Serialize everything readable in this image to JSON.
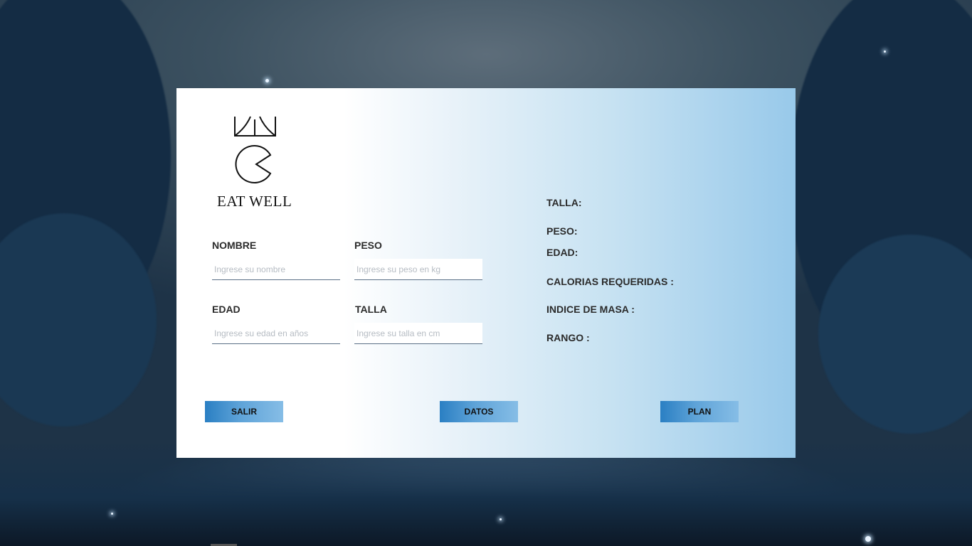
{
  "app": {
    "logo_text": "EAT WELL"
  },
  "form": {
    "nombre": {
      "label": "NOMBRE",
      "placeholder": "Ingrese su nombre",
      "value": ""
    },
    "peso": {
      "label": "PESO",
      "placeholder": "Ingrese su peso en kg",
      "value": ""
    },
    "edad": {
      "label": "EDAD",
      "placeholder": "Ingrese su edad en años",
      "value": ""
    },
    "talla": {
      "label": "TALLA",
      "placeholder": "Ingrese su talla en cm",
      "value": ""
    }
  },
  "results": {
    "talla": "TALLA:",
    "peso": "PESO:",
    "edad": "EDAD:",
    "calorias": "CALORIAS REQUERIDAS :",
    "indice": "INDICE DE MASA :",
    "rango": "RANGO :"
  },
  "buttons": {
    "salir": "SALIR",
    "datos": "DATOS",
    "plan": "PLAN"
  },
  "colors": {
    "button_gradient_start": "#2a7fc3",
    "button_gradient_end": "#86bde6",
    "panel_right": "#98c9ea",
    "background": "#1e3347"
  }
}
